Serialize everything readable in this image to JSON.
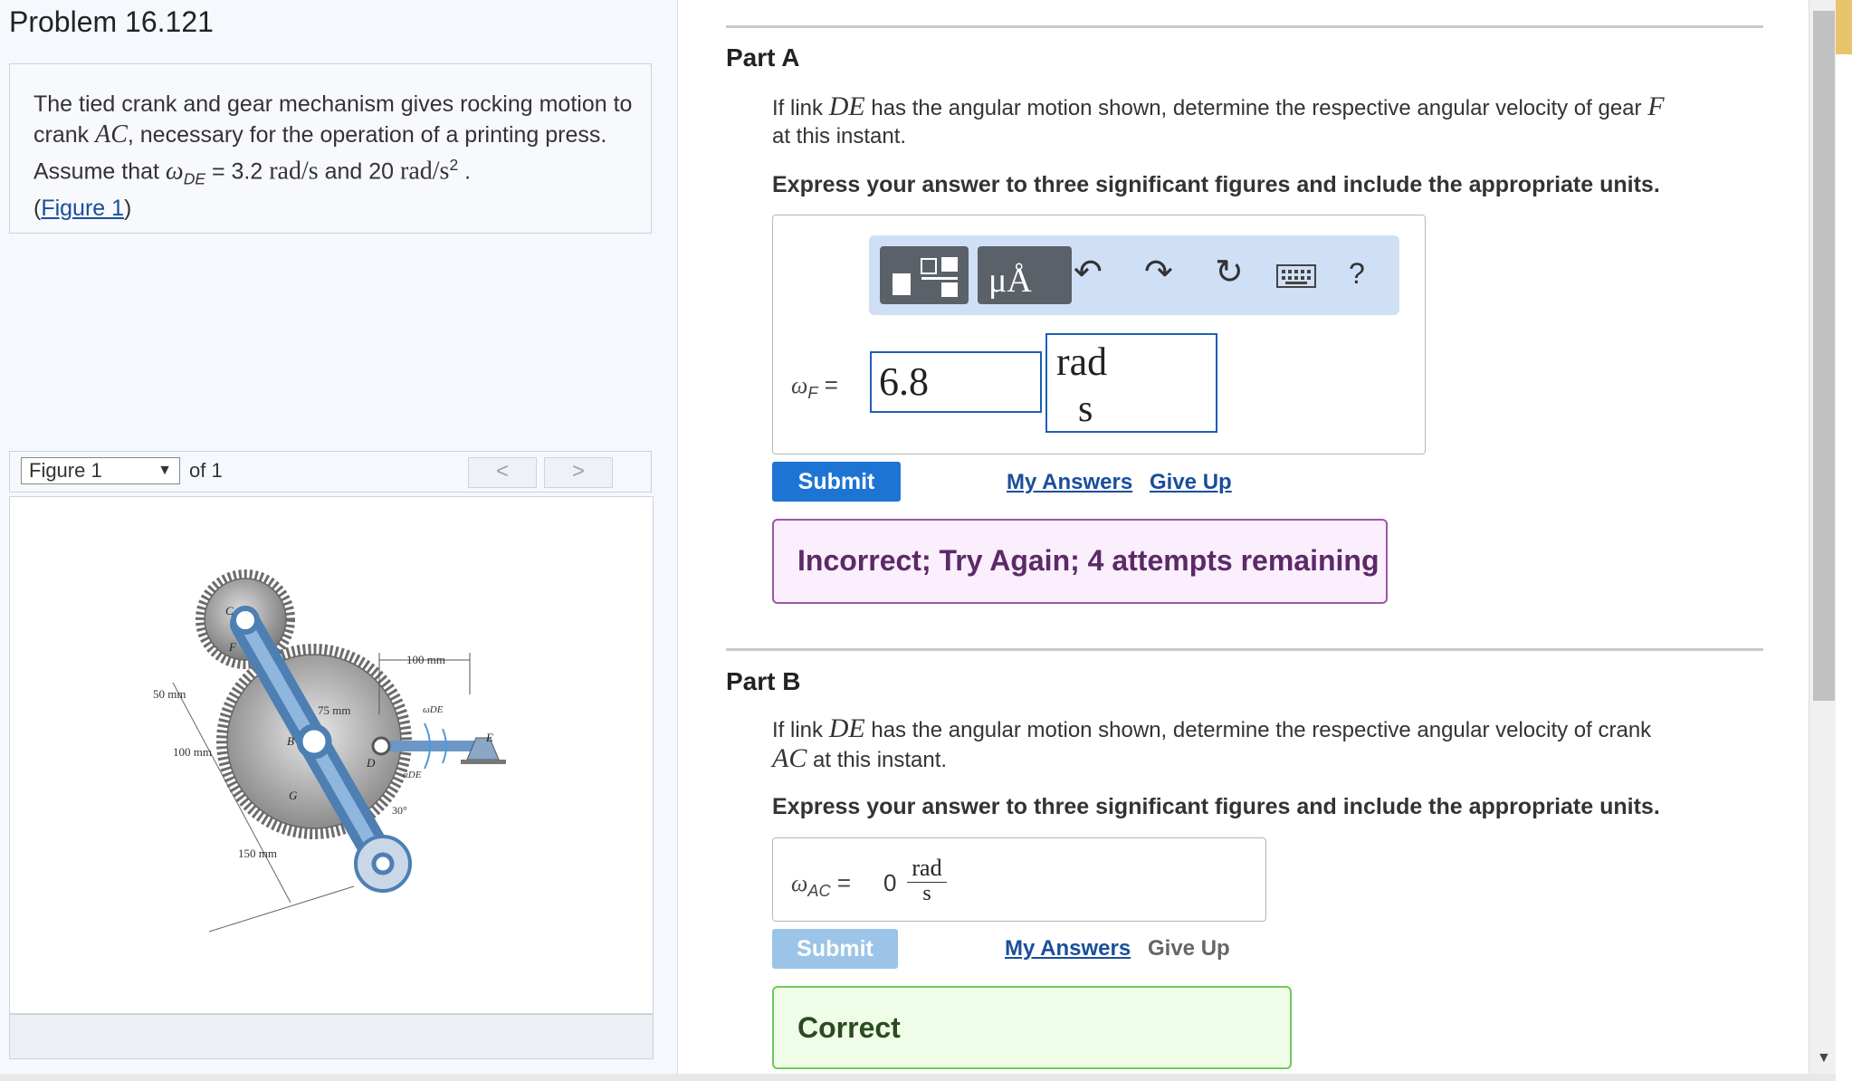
{
  "problem": {
    "title": "Problem 16.121",
    "text_1": "The tied crank and gear mechanism gives rocking motion to crank ",
    "ac": "AC",
    "text_2": ", necessary for the operation of a printing press. Assume that ",
    "omega_de": "ω",
    "omega_de_sub": "DE",
    "text_3": " = 3.2 ",
    "unit_rad_s": "rad/s",
    "text_4": " and 20 ",
    "unit_rad_s2": "rad/s",
    "unit_sup": "2",
    "text_5": " .",
    "figure_link_open": "(",
    "figure_link": "Figure 1",
    "figure_link_close": ")"
  },
  "figure_nav": {
    "select_value": "Figure 1",
    "of_label": "of 1",
    "prev": "<",
    "next": ">"
  },
  "figure": {
    "dim_100mm_top": "100 mm",
    "dim_50mm": "50 mm",
    "dim_75mm": "75 mm",
    "dim_100mm_left": "100 mm",
    "dim_150mm": "150 mm",
    "angle_30": "30°",
    "label_c": "C",
    "label_f": "F",
    "label_b": "B",
    "label_d": "D",
    "label_e": "E",
    "label_g": "G",
    "label_omega_de": "ωDE",
    "label_alpha_de": "αDE"
  },
  "part_a": {
    "title": "Part A",
    "q_1": "If link ",
    "q_de": "DE",
    "q_2": " has the angular motion shown, determine the respective angular velocity of gear ",
    "q_f": "F",
    "q_3": "at this instant.",
    "instruction": "Express your answer to three significant figures and include the appropriate units.",
    "toolbar": {
      "units_label": "μÅ",
      "help": "?"
    },
    "answer_label": "ωF =",
    "answer_label_omega": "ω",
    "answer_label_sub": "F",
    "answer_label_eq": " =",
    "answer_value": "6.8",
    "unit_numerator": "rad",
    "unit_denominator": "s",
    "submit": "Submit",
    "my_answers": "My Answers",
    "give_up": "Give Up",
    "feedback": "Incorrect; Try Again; 4 attempts remaining"
  },
  "part_b": {
    "title": "Part B",
    "q_1": "If link ",
    "q_de": "DE",
    "q_2": " has the angular motion shown, determine the respective angular velocity of crank",
    "q_ac": "AC",
    "q_3": " at this instant.",
    "instruction": "Express your answer to three significant figures and include the appropriate units.",
    "answer_label_omega": "ω",
    "answer_label_sub": "AC",
    "answer_label_eq": " =",
    "answer_value": "0",
    "unit_numerator": "rad",
    "unit_denominator": "s",
    "submit": "Submit",
    "my_answers": "My Answers",
    "give_up": "Give Up",
    "feedback": "Correct"
  },
  "colors": {
    "accent": "#1d74d3",
    "submit_disabled": "#9cc4e8",
    "incorrect_bg": "#fbeefd",
    "correct_bg": "#effde8"
  }
}
